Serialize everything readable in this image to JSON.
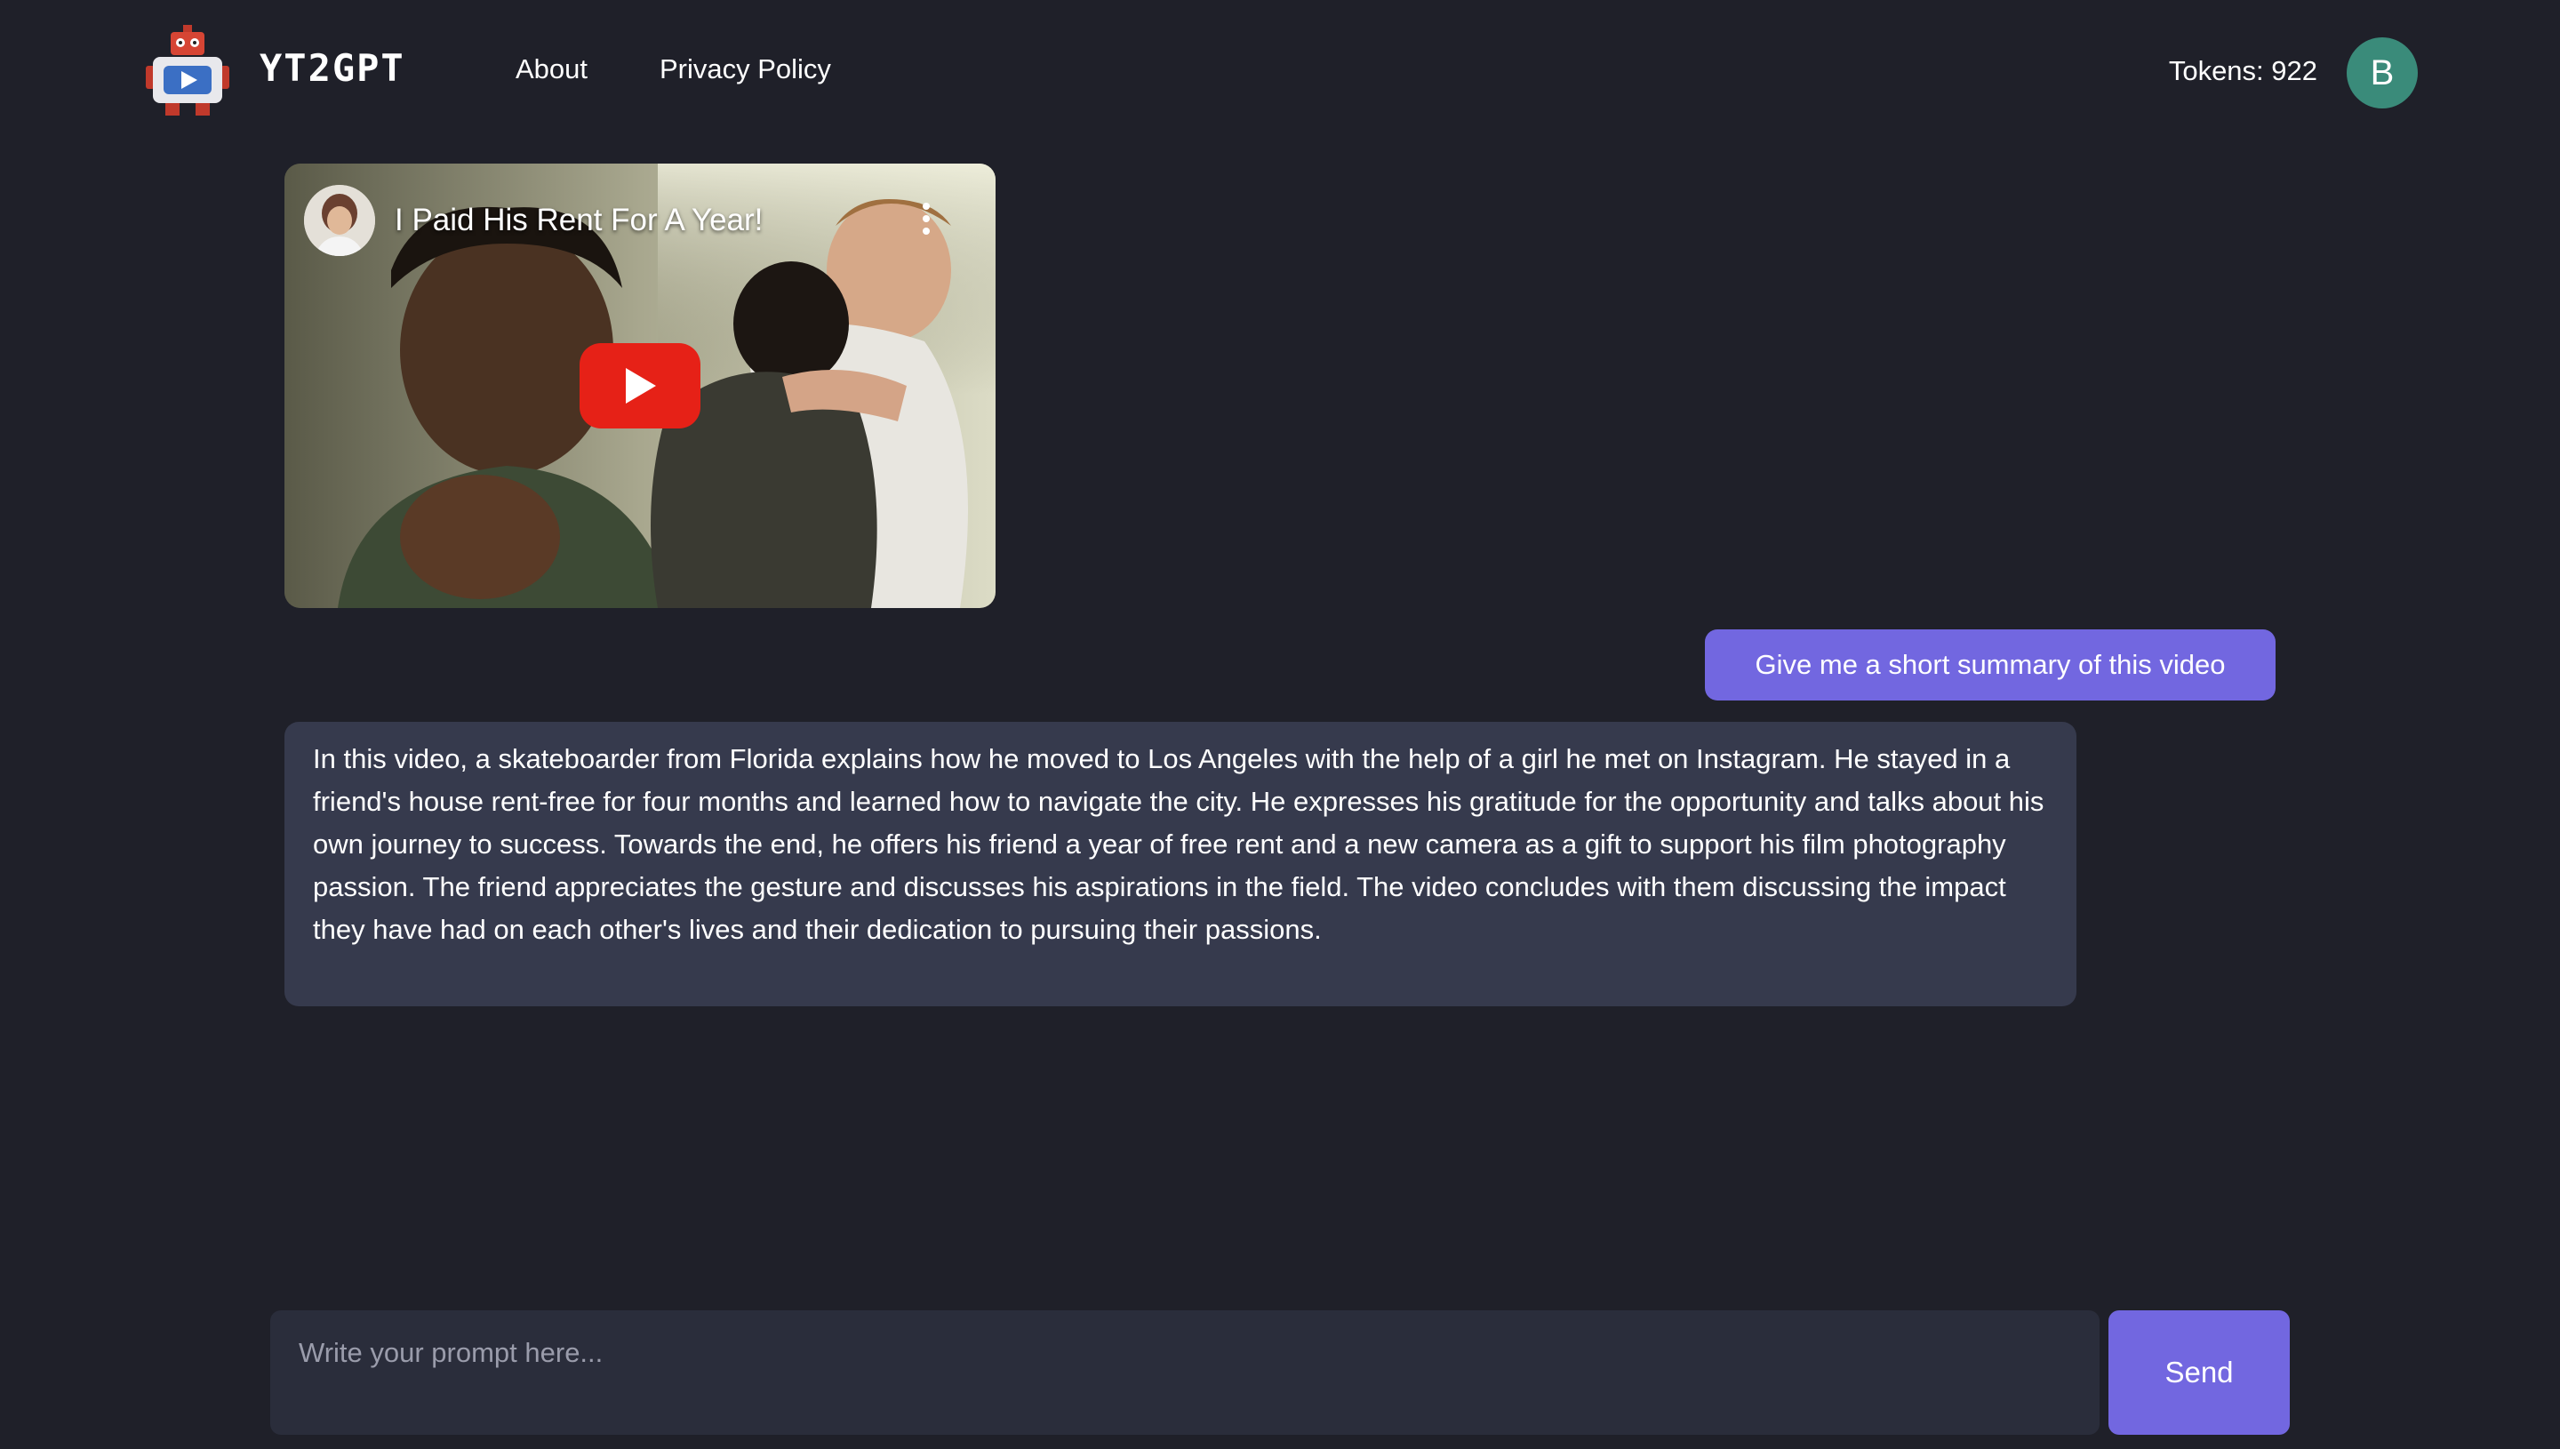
{
  "header": {
    "logo_icon": "robot-logo-icon",
    "brand": "YT2GPT",
    "nav": [
      {
        "label": "About"
      },
      {
        "label": "Privacy Policy"
      }
    ],
    "tokens_label": "Tokens: 922",
    "avatar_initial": "B",
    "avatar_color": "#3a8b7a"
  },
  "video": {
    "title": "I Paid His Rent For A Year!",
    "play_icon": "youtube-play-icon",
    "menu_icon": "more-vertical-icon",
    "play_color": "#e62117"
  },
  "chat": {
    "user_message": "Give me a short summary of this video",
    "bot_message": "In this video, a skateboarder from Florida explains how he moved to Los Angeles with the help of a girl he met on Instagram. He stayed in a friend's house rent-free for four months and learned how to navigate the city. He expresses his gratitude for the opportunity and talks about his own journey to success. Towards the end, he offers his friend a year of free rent and a new camera as a gift to support his film photography passion. The friend appreciates the gesture and discusses his aspirations in the field. The video concludes with them discussing the impact they have had on each other's lives and their dedication to pursuing their passions.",
    "accent_color": "#7267e0"
  },
  "prompt": {
    "placeholder": "Write your prompt here...",
    "value": "",
    "send_label": "Send"
  }
}
